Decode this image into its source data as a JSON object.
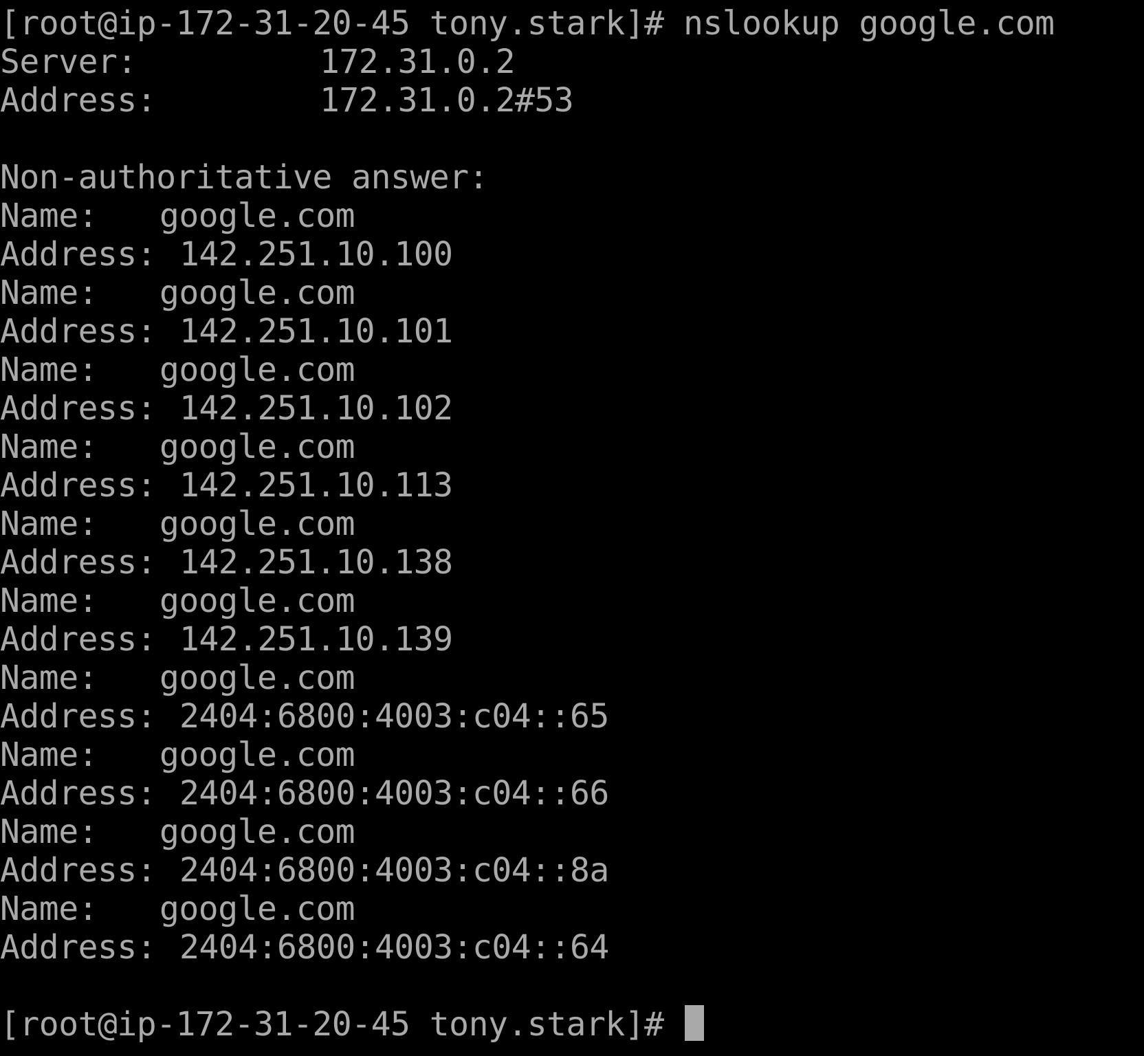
{
  "terminal": {
    "prompt": "[root@ip-172-31-20-45 tony.stark]# ",
    "command": "nslookup google.com",
    "server_label": "Server:",
    "server_value": "172.31.0.2",
    "address_label": "Address:",
    "server_address_value": "172.31.0.2#53",
    "answer_header": "Non-authoritative answer:",
    "name_label": "Name:",
    "records": [
      {
        "name": "google.com",
        "address": "142.251.10.100"
      },
      {
        "name": "google.com",
        "address": "142.251.10.101"
      },
      {
        "name": "google.com",
        "address": "142.251.10.102"
      },
      {
        "name": "google.com",
        "address": "142.251.10.113"
      },
      {
        "name": "google.com",
        "address": "142.251.10.138"
      },
      {
        "name": "google.com",
        "address": "142.251.10.139"
      },
      {
        "name": "google.com",
        "address": "2404:6800:4003:c04::65"
      },
      {
        "name": "google.com",
        "address": "2404:6800:4003:c04::66"
      },
      {
        "name": "google.com",
        "address": "2404:6800:4003:c04::8a"
      },
      {
        "name": "google.com",
        "address": "2404:6800:4003:c04::64"
      }
    ],
    "colors": {
      "background": "#000000",
      "text": "#a9a9a9",
      "cursor": "#a9a9a9"
    }
  }
}
